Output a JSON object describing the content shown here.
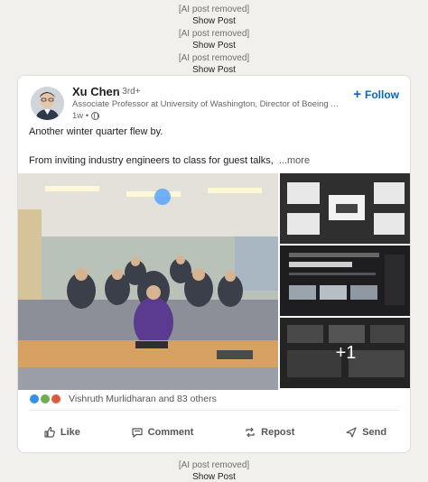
{
  "removed_notices": [
    {
      "label": "[AI post removed]",
      "action": "Show Post"
    },
    {
      "label": "[AI post removed]",
      "action": "Show Post"
    },
    {
      "label": "[AI post removed]",
      "action": "Show Post"
    },
    {
      "label": "[AI post removed]",
      "action": "Show Post"
    }
  ],
  "post": {
    "author": {
      "name": "Xu Chen",
      "degree": "• 3rd+",
      "title": "Associate Professor at University of Washington, Director of Boeing Ad...",
      "time": "1w •"
    },
    "follow_label": "Follow",
    "text_line1": "Another winter quarter flew by.",
    "text_line2": "From inviting industry engineers to class for guest talks,",
    "more_label": "...more",
    "extra_images": "+1",
    "reactions": {
      "summary": "Vishruth Murlidharan and 83 others"
    },
    "actions": {
      "like": "Like",
      "comment": "Comment",
      "repost": "Repost",
      "send": "Send"
    }
  },
  "colors": {
    "accent": "#0a66c2",
    "background": "#f1f0ec"
  }
}
